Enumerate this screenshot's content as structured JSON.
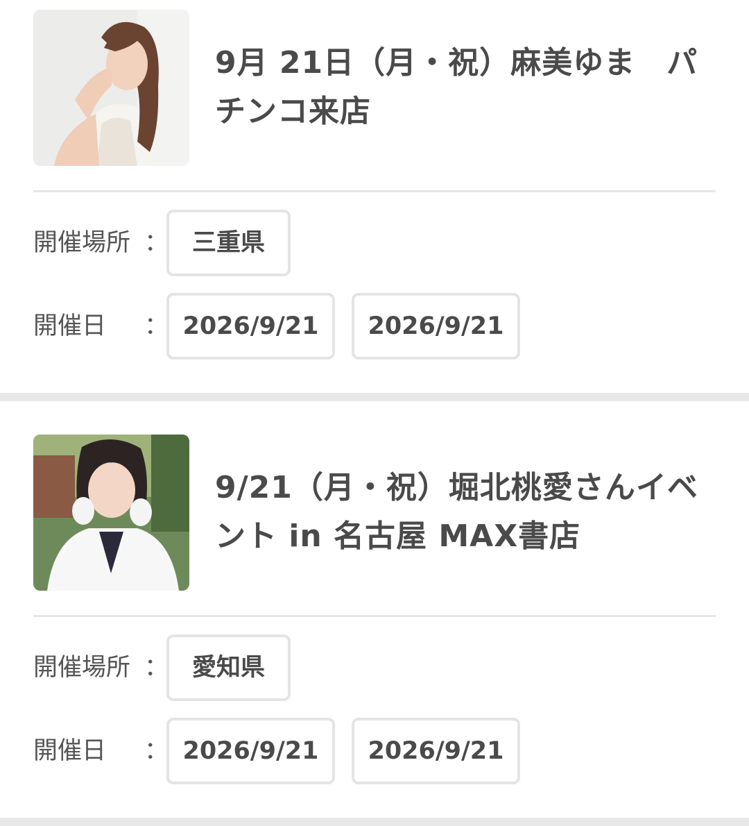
{
  "events": [
    {
      "title": "9月 21日（月・祝）麻美ゆま　パチンコ来店",
      "location_label": "開催場所",
      "location": "三重県",
      "date_label": "開催日",
      "colon": "：",
      "dates": [
        "2026/9/21",
        "2026/9/21"
      ]
    },
    {
      "title": "9/21（月・祝）堀北桃愛さんイベント in 名古屋 MAX書店",
      "location_label": "開催場所",
      "location": "愛知県",
      "date_label": "開催日",
      "colon": "：",
      "dates": [
        "2026/9/21",
        "2026/9/21"
      ]
    }
  ]
}
